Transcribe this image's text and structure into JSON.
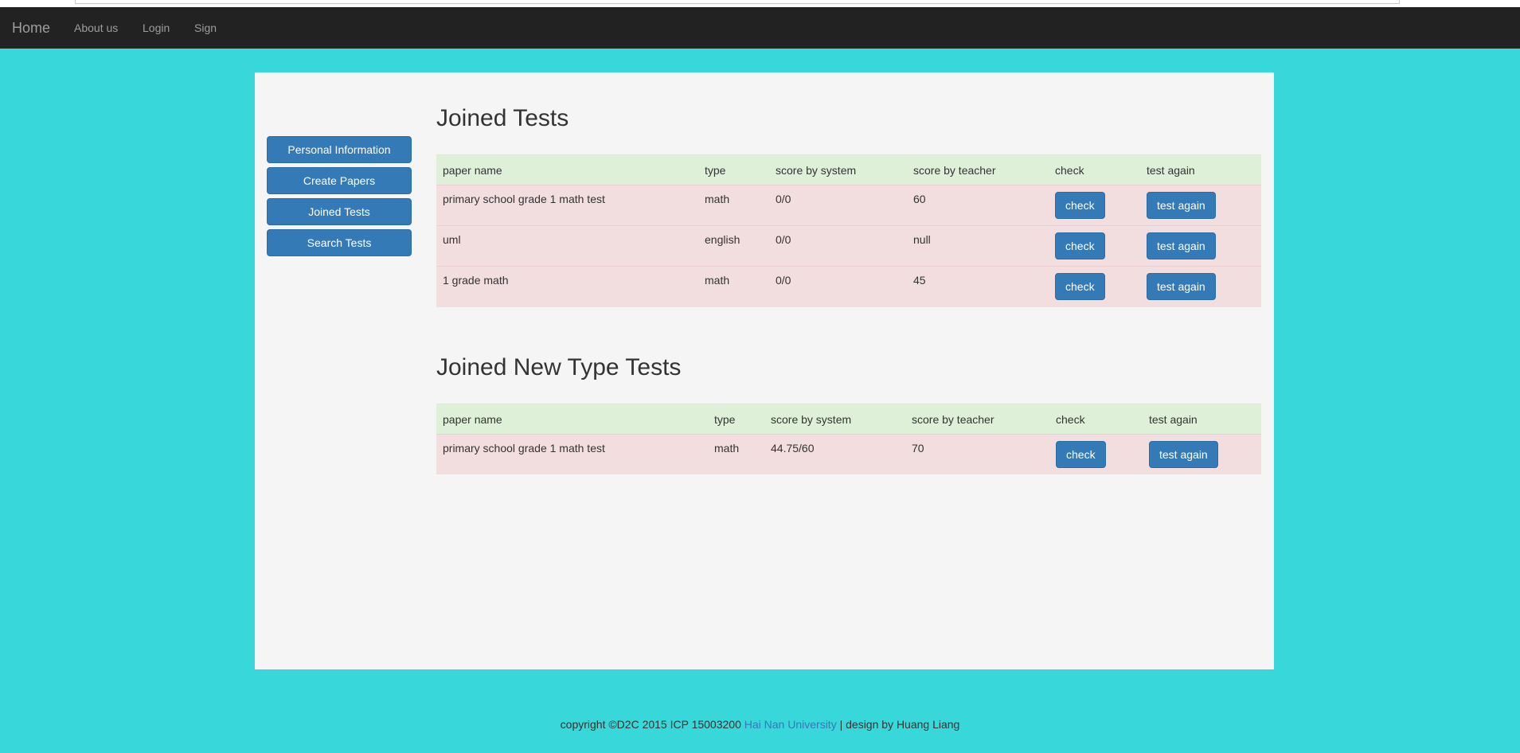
{
  "navbar": {
    "brand": "Home",
    "links": [
      "About us",
      "Login",
      "Sign"
    ]
  },
  "sidebar": {
    "buttons": [
      "Personal Information",
      "Create Papers",
      "Joined Tests",
      "Search Tests"
    ]
  },
  "joined_tests": {
    "title": "Joined Tests",
    "headers": [
      "paper name",
      "type",
      "score by system",
      "score by teacher",
      "check",
      "test again"
    ],
    "rows": [
      {
        "paper_name": "primary school grade 1 math test",
        "type": "math",
        "score_system": "0/0",
        "score_teacher": "60",
        "check": "check",
        "test_again": "test again"
      },
      {
        "paper_name": "uml",
        "type": "english",
        "score_system": "0/0",
        "score_teacher": "null",
        "check": "check",
        "test_again": "test again"
      },
      {
        "paper_name": "1 grade math",
        "type": "math",
        "score_system": "0/0",
        "score_teacher": "45",
        "check": "check",
        "test_again": "test again"
      }
    ]
  },
  "joined_new_type_tests": {
    "title": "Joined New Type Tests",
    "headers": [
      "paper name",
      "type",
      "score by system",
      "score by teacher",
      "check",
      "test again"
    ],
    "rows": [
      {
        "paper_name": "primary school grade 1 math test",
        "type": "math",
        "score_system": "44.75/60",
        "score_teacher": "70",
        "check": "check",
        "test_again": "test again"
      }
    ]
  },
  "footer": {
    "prefix": "copyright ©D2C 2015 ICP 15003200 ",
    "link": "Hai Nan University",
    "suffix": " | design by Huang Liang"
  },
  "colors": {
    "page_background": "#38d7d9",
    "navbar": "#222222",
    "primary_button": "#337ab7",
    "table_header": "#dff0d8",
    "table_row": "#f2dede"
  }
}
